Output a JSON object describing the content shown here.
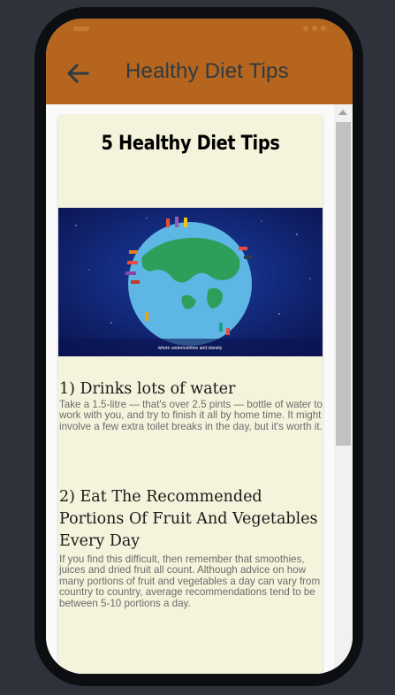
{
  "app": {
    "title": "Healthy Diet Tips",
    "accent_color": "#b5651d",
    "back_icon": "arrow-left-icon"
  },
  "article": {
    "title": "5 Healthy Diet Tips",
    "image": {
      "caption": "where undernutrition and obesity"
    },
    "tips": [
      {
        "heading": "1) Drinks lots of water",
        "body": "Take a 1.5-litre — that's over 2.5 pints — bottle of water to work with you, and try to finish it all by home time. It might involve a few extra toilet breaks in the day, but it's worth it."
      },
      {
        "heading": "2) Eat The Recommended Portions Of Fruit And Vegetables Every Day",
        "body": "If you find this difficult, then remember that smoothies, juices and dried fruit all count. Although advice on how many portions of fruit and vegetables a day can vary from country to country, average recommendations tend to be between 5-10 portions a day."
      }
    ]
  }
}
